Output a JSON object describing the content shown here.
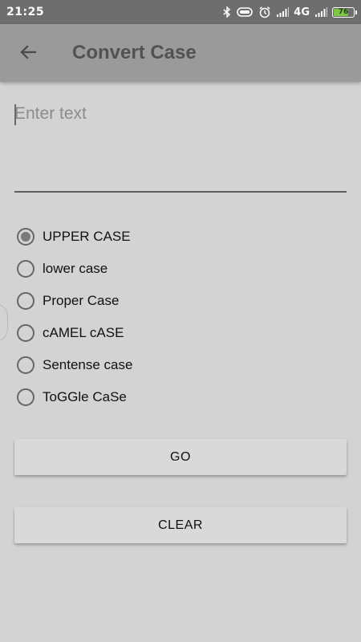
{
  "status_bar": {
    "time": "21:25",
    "network": "4G",
    "battery_level": 76,
    "battery_text": "76",
    "battery_color": "#7cc644",
    "icons": [
      "bluetooth-icon",
      "vibrate-icon",
      "alarm-icon",
      "signal-icon",
      "signal-icon",
      "battery-icon"
    ]
  },
  "app_bar": {
    "title": "Convert Case",
    "back_icon": "arrow-back-icon"
  },
  "input": {
    "placeholder": "Enter text",
    "value": ""
  },
  "radio_options": [
    {
      "label": "UPPER CASE",
      "selected": true
    },
    {
      "label": "lower case",
      "selected": false
    },
    {
      "label": "Proper Case",
      "selected": false
    },
    {
      "label": "cAMEL cASE",
      "selected": false
    },
    {
      "label": "Sentense case",
      "selected": false
    },
    {
      "label": "ToGGle CaSe",
      "selected": false
    }
  ],
  "buttons": {
    "go_label": "GO",
    "clear_label": "CLEAR"
  },
  "colors": {
    "background": "#d3d3d3",
    "status_bar": "#6e6e6e",
    "app_bar": "#9a9a9a",
    "title_text": "#525252"
  }
}
